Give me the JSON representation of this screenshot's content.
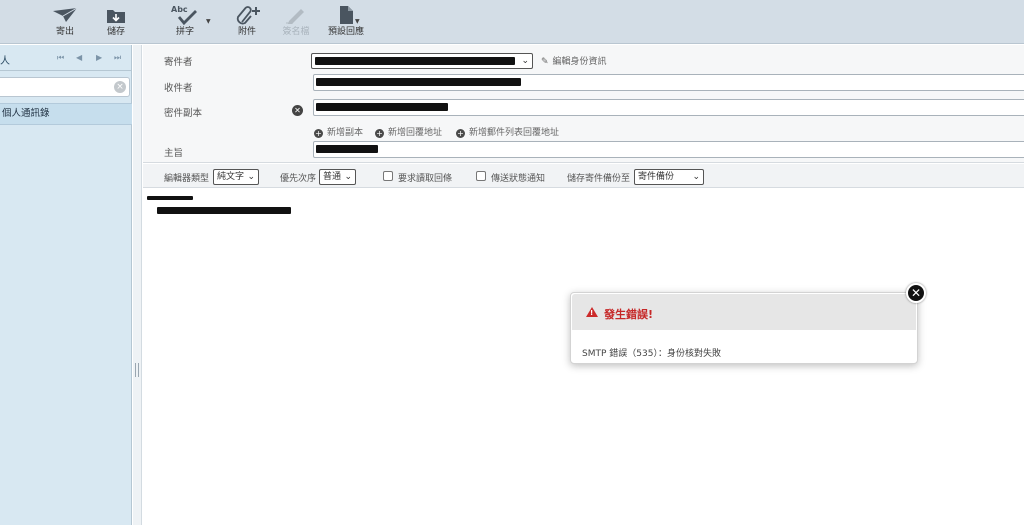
{
  "toolbar": {
    "send_label": "寄出",
    "save_label": "儲存",
    "spell_label": "拼字",
    "spell_icon_text": "Abc",
    "attach_label": "附件",
    "signature_label": "簽名檔",
    "receipt_label": "預設回應"
  },
  "sidebar": {
    "header_text": "人",
    "contacts_item": "個人通訊錄"
  },
  "compose": {
    "from_label": "寄件者",
    "to_label": "收件者",
    "cc_label": "密件副本",
    "subject_label": "主旨",
    "edit_identity": "編輯身份資訊",
    "add_cc": "新增副本",
    "add_reply_to": "新增回覆地址",
    "add_followup": "新增郵件列表回覆地址"
  },
  "options": {
    "editor_type_label": "編輯器類型",
    "editor_type_value": "純文字",
    "priority_label": "優先次序",
    "priority_value": "普通",
    "read_receipt_label": "要求讀取回條",
    "dsn_label": "傳送狀態通知",
    "save_sent_label": "儲存寄件備份至",
    "save_sent_value": "寄件備份"
  },
  "dialog": {
    "title": "發生錯誤!",
    "message": "SMTP 錯誤（535）：身份核對失敗"
  },
  "colors": {
    "toolbar_bg": "#d3dde6",
    "sidebar_bg": "#d8e8f2",
    "error_red": "#c62828"
  }
}
